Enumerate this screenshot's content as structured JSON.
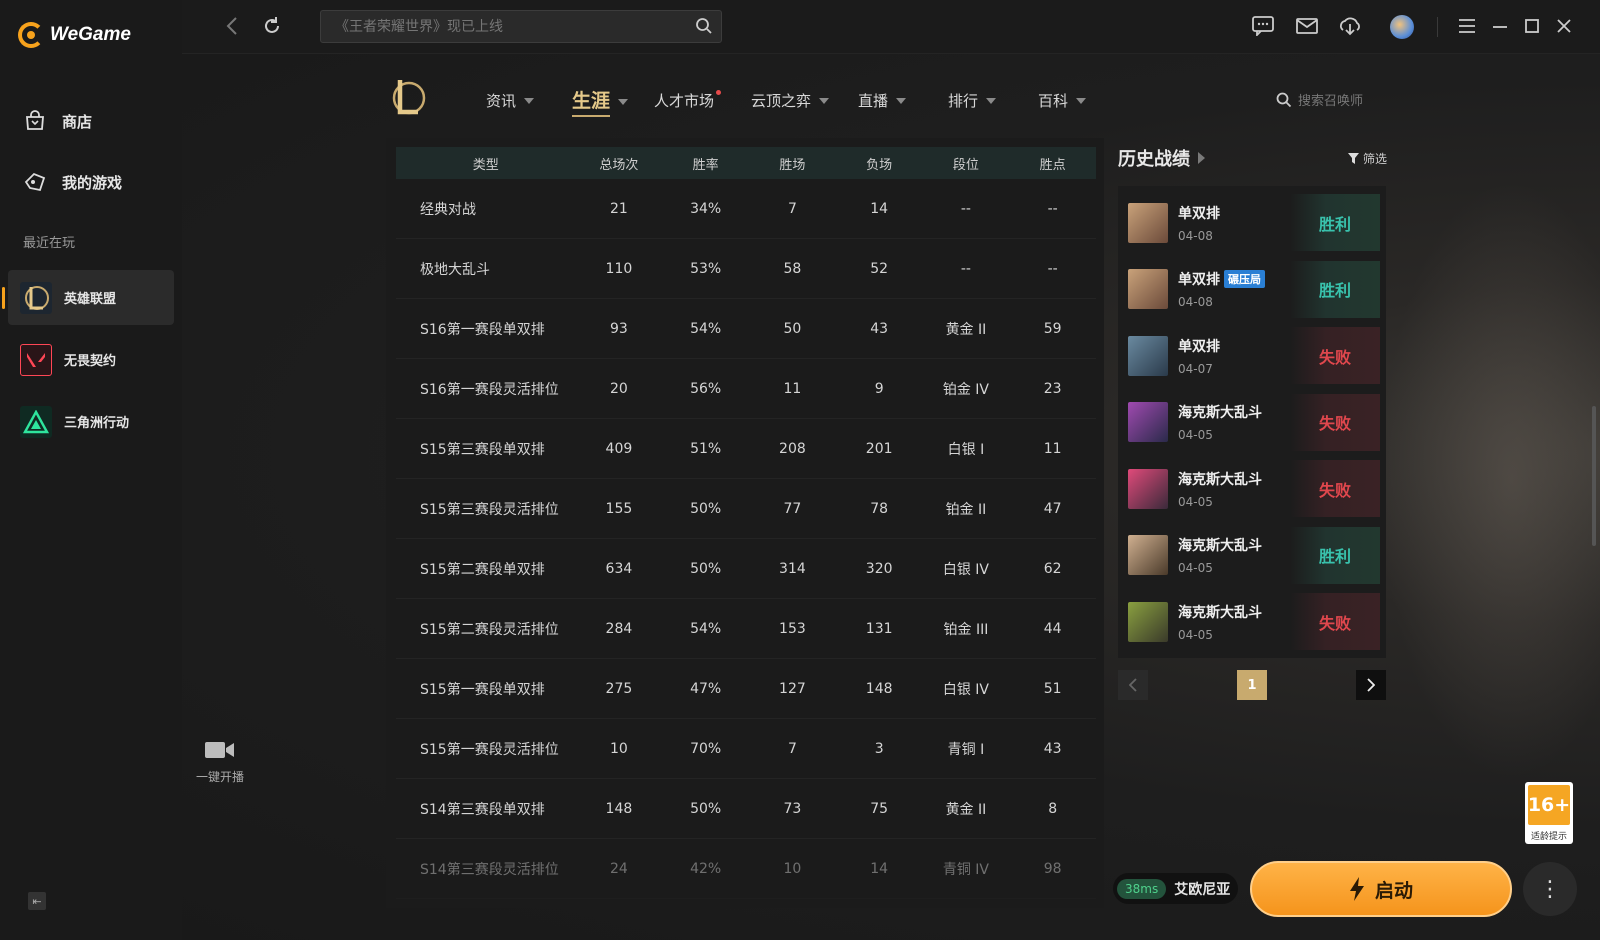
{
  "app": {
    "brand": "WeGame"
  },
  "sidebar": {
    "nav": [
      {
        "label": "商店",
        "icon": "store-icon"
      },
      {
        "label": "我的游戏",
        "icon": "games-icon"
      }
    ],
    "recent_label": "最近在玩",
    "games": [
      {
        "label": "英雄联盟",
        "active": true
      },
      {
        "label": "无畏契约",
        "active": false
      },
      {
        "label": "三角洲行动",
        "active": false
      }
    ],
    "stream_label": "一键开播"
  },
  "topbar": {
    "search_placeholder": "《王者荣耀世界》现已上线"
  },
  "game_nav": {
    "items": [
      {
        "label": "资讯"
      },
      {
        "label": "生涯"
      },
      {
        "label": "人才市场"
      },
      {
        "label": "云顶之弈"
      },
      {
        "label": "直播"
      },
      {
        "label": "排行"
      },
      {
        "label": "百科"
      }
    ],
    "search_placeholder": "搜索召唤师"
  },
  "table": {
    "headers": [
      "类型",
      "总场次",
      "胜率",
      "胜场",
      "负场",
      "段位",
      "胜点"
    ],
    "rows": [
      [
        "经典对战",
        "21",
        "34%",
        "7",
        "14",
        "--",
        "--"
      ],
      [
        "极地大乱斗",
        "110",
        "53%",
        "58",
        "52",
        "--",
        "--"
      ],
      [
        "S16第一赛段单双排",
        "93",
        "54%",
        "50",
        "43",
        "黄金 II",
        "59"
      ],
      [
        "S16第一赛段灵活排位",
        "20",
        "56%",
        "11",
        "9",
        "铂金 IV",
        "23"
      ],
      [
        "S15第三赛段单双排",
        "409",
        "51%",
        "208",
        "201",
        "白银 I",
        "11"
      ],
      [
        "S15第三赛段灵活排位",
        "155",
        "50%",
        "77",
        "78",
        "铂金 II",
        "47"
      ],
      [
        "S15第二赛段单双排",
        "634",
        "50%",
        "314",
        "320",
        "白银 IV",
        "62"
      ],
      [
        "S15第二赛段灵活排位",
        "284",
        "54%",
        "153",
        "131",
        "铂金 III",
        "44"
      ],
      [
        "S15第一赛段单双排",
        "275",
        "47%",
        "127",
        "148",
        "白银 IV",
        "51"
      ],
      [
        "S15第一赛段灵活排位",
        "10",
        "70%",
        "7",
        "3",
        "青铜 I",
        "43"
      ],
      [
        "S14第三赛段单双排",
        "148",
        "50%",
        "73",
        "75",
        "黄金 II",
        "8"
      ],
      [
        "S14第三赛段灵活排位",
        "24",
        "42%",
        "10",
        "14",
        "青铜 IV",
        "98"
      ]
    ]
  },
  "history": {
    "title": "历史战绩",
    "filter_label": "筛选",
    "matches": [
      {
        "type": "单双排",
        "date": "04-08",
        "result": "胜利",
        "win": true,
        "badge": ""
      },
      {
        "type": "单双排",
        "date": "04-08",
        "result": "胜利",
        "win": true,
        "badge": "碾压局"
      },
      {
        "type": "单双排",
        "date": "04-07",
        "result": "失败",
        "win": false,
        "badge": ""
      },
      {
        "type": "海克斯大乱斗",
        "date": "04-05",
        "result": "失败",
        "win": false,
        "badge": ""
      },
      {
        "type": "海克斯大乱斗",
        "date": "04-05",
        "result": "失败",
        "win": false,
        "badge": ""
      },
      {
        "type": "海克斯大乱斗",
        "date": "04-05",
        "result": "胜利",
        "win": true,
        "badge": ""
      },
      {
        "type": "海克斯大乱斗",
        "date": "04-05",
        "result": "失败",
        "win": false,
        "badge": ""
      }
    ],
    "page": "1"
  },
  "launch": {
    "ping": "38ms",
    "server": "艾欧尼亚",
    "button": "启动"
  },
  "age_rating": {
    "num": "16+",
    "label": "适龄提示"
  },
  "colors": {
    "accent": "#f7a21c",
    "gold": "#c8aa6e",
    "win": "#39c2ad",
    "lose": "#e0474d"
  }
}
